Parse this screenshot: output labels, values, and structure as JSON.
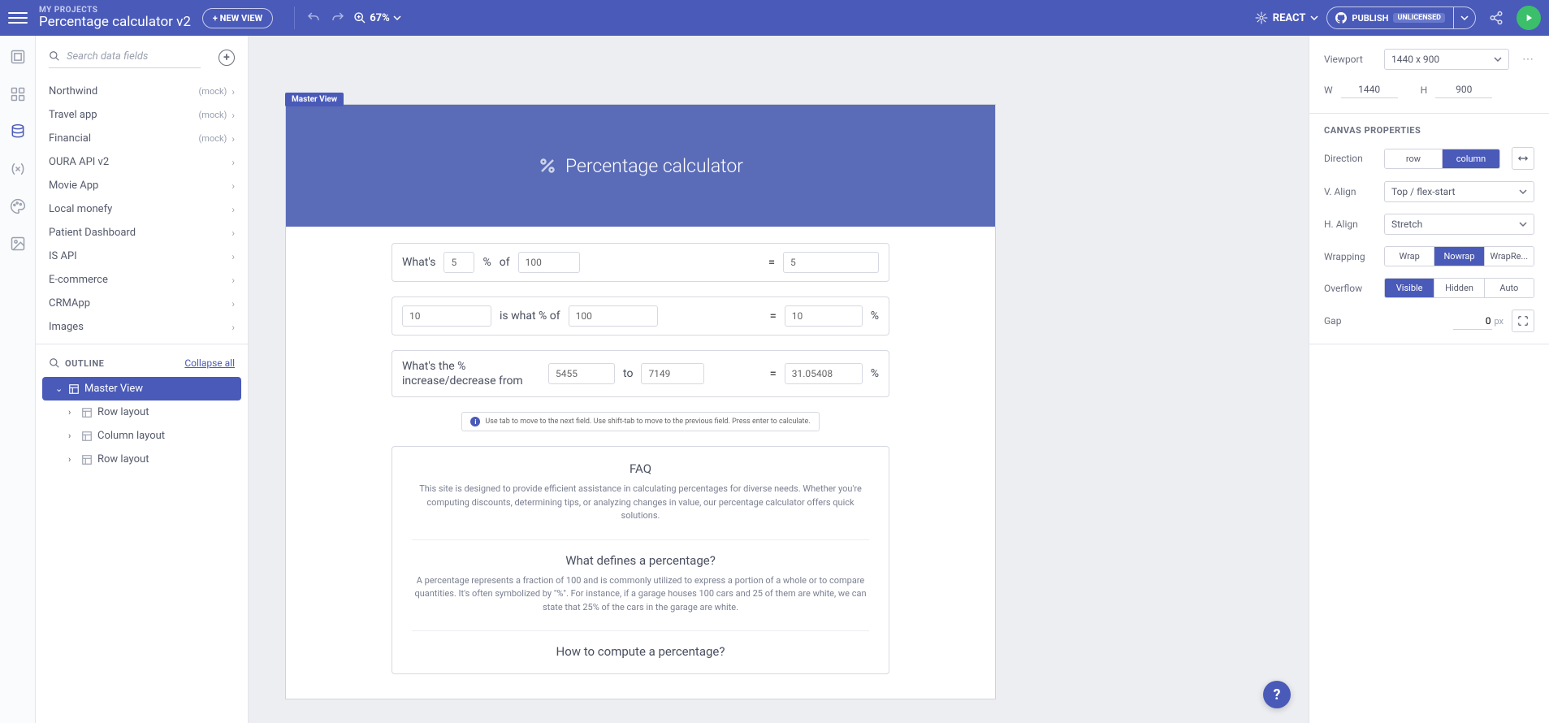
{
  "topbar": {
    "projects_label": "MY PROJECTS",
    "project_name": "Percentage calculator v2",
    "new_view": "+ NEW VIEW",
    "zoom": "67%",
    "framework": "REACT",
    "publish": "PUBLISH",
    "license": "UNLICENSED"
  },
  "sidebar": {
    "search_placeholder": "Search data fields",
    "items": [
      {
        "name": "Northwind",
        "mock": "(mock)"
      },
      {
        "name": "Travel app",
        "mock": "(mock)"
      },
      {
        "name": "Financial",
        "mock": "(mock)"
      },
      {
        "name": "OURA API v2",
        "mock": ""
      },
      {
        "name": "Movie App",
        "mock": ""
      },
      {
        "name": "Local monefy",
        "mock": ""
      },
      {
        "name": "Patient Dashboard",
        "mock": ""
      },
      {
        "name": "IS API",
        "mock": ""
      },
      {
        "name": "E-commerce",
        "mock": ""
      },
      {
        "name": "CRMApp",
        "mock": ""
      },
      {
        "name": "Images",
        "mock": ""
      }
    ],
    "outline_label": "OUTLINE",
    "collapse": "Collapse all",
    "tree": [
      {
        "label": "Master View",
        "active": true,
        "child": false
      },
      {
        "label": "Row layout",
        "active": false,
        "child": true
      },
      {
        "label": "Column layout",
        "active": false,
        "child": true
      },
      {
        "label": "Row layout",
        "active": false,
        "child": true
      }
    ]
  },
  "canvas": {
    "view_label": "Master View",
    "hero_title": "Percentage calculator",
    "row1": {
      "t1": "What's",
      "v1": "5",
      "pct": "%",
      "of": "of",
      "v2": "100",
      "eq": "=",
      "res": "5"
    },
    "row2": {
      "v1": "10",
      "mid": "is what % of",
      "v2": "100",
      "eq": "=",
      "res": "10",
      "pct": "%"
    },
    "row3": {
      "t1": "What's the % increase/decrease from",
      "v1": "5455",
      "to": "to",
      "v2": "7149",
      "eq": "=",
      "res": "31.05408",
      "pct": "%"
    },
    "tip": "Use tab to move to the next field. Use shift-tab to move to the previous field. Press enter to calculate.",
    "faq": {
      "h": "FAQ",
      "intro": "This site is designed to provide efficient assistance in calculating percentages for diverse needs. Whether you're computing discounts, determining tips, or analyzing changes in value, our percentage calculator offers quick solutions.",
      "q1": "What defines a percentage?",
      "a1": "A percentage represents a fraction of 100 and is commonly utilized to express a portion of a whole or to compare quantities. It's often symbolized by \"%\". For instance, if a garage houses 100 cars and 25 of them are white, we can state that 25% of the cars in the garage are white.",
      "q2": "How to compute a percentage?"
    }
  },
  "props": {
    "viewport_label": "Viewport",
    "viewport_value": "1440 x 900",
    "w_label": "W",
    "w_value": "1440",
    "h_label": "H",
    "h_value": "900",
    "section": "CANVAS PROPERTIES",
    "direction_label": "Direction",
    "direction_opts": [
      "row",
      "column"
    ],
    "direction_active": 1,
    "valign_label": "V. Align",
    "valign_value": "Top / flex-start",
    "halign_label": "H. Align",
    "halign_value": "Stretch",
    "wrapping_label": "Wrapping",
    "wrapping_opts": [
      "Wrap",
      "Nowrap",
      "WrapRe..."
    ],
    "wrapping_active": 1,
    "overflow_label": "Overflow",
    "overflow_opts": [
      "Visible",
      "Hidden",
      "Auto"
    ],
    "overflow_active": 0,
    "gap_label": "Gap",
    "gap_value": "0",
    "gap_unit": "px"
  },
  "help": "?"
}
